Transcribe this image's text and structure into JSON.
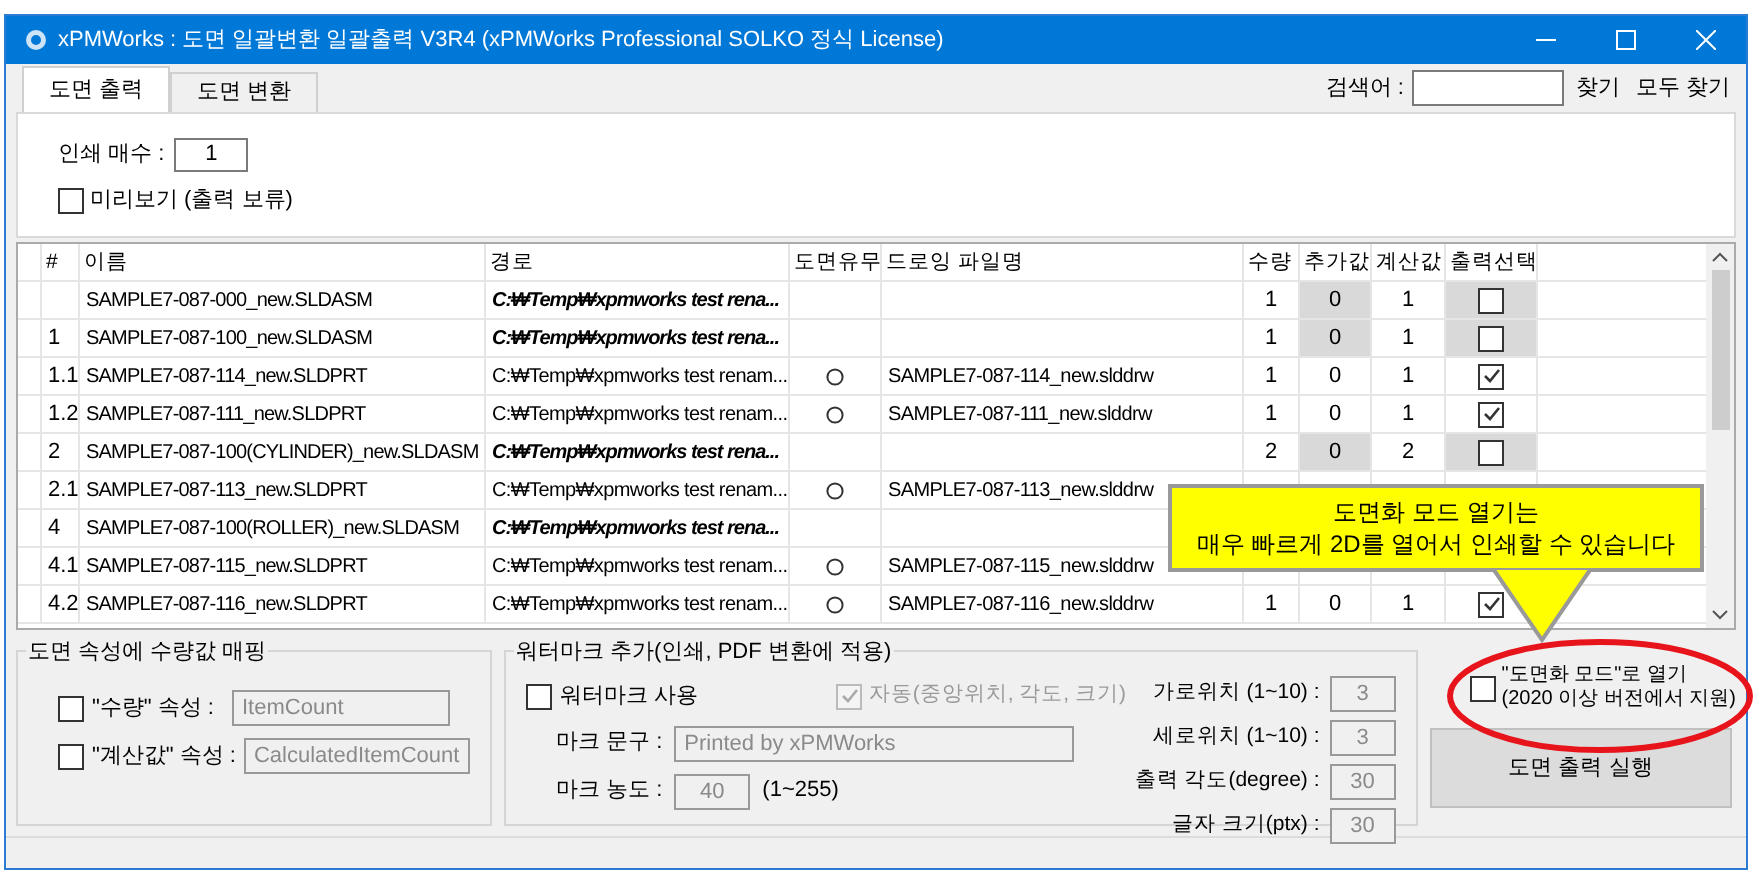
{
  "window": {
    "title": "xPMWorks : 도면 일괄변환 일괄출력 V3R4 (xPMWorks Professional SOLKO 정식 License)"
  },
  "tabs": [
    {
      "label": "도면 출력",
      "selected": true
    },
    {
      "label": "도면 변환",
      "selected": false
    }
  ],
  "search": {
    "label": "검색어 :",
    "buttons": [
      "찾기",
      "모두 찾기"
    ]
  },
  "print_count": {
    "label": "인쇄 매수 :",
    "value": "1"
  },
  "preview": {
    "label": "미리보기 (출력 보류)",
    "checked": false
  },
  "table": {
    "columns": [
      "#",
      "이름",
      "경로",
      "도면유무",
      "드로잉 파일명",
      "수량",
      "추가값",
      "계산값",
      "출력선택"
    ],
    "rows": [
      {
        "kind": "assembly",
        "name": "SAMPLE7-087-000_new.SLDASM",
        "path": "C:₩Temp₩xpmworks test rena...",
        "has_drawing": false,
        "qty": "1",
        "add": "0",
        "calc": "1",
        "checked": false
      },
      {
        "kind": "assembly",
        "num": "1",
        "name": "SAMPLE7-087-100_new.SLDASM",
        "path": "C:₩Temp₩xpmworks test rena...",
        "has_drawing": false,
        "qty": "1",
        "add": "0",
        "calc": "1",
        "checked": false
      },
      {
        "kind": "part",
        "num": "1.1",
        "name": "SAMPLE7-087-114_new.SLDPRT",
        "path": "C:₩Temp₩xpmworks test renam...",
        "has_drawing": true,
        "drawing": "SAMPLE7-087-114_new.slddrw",
        "qty": "1",
        "add": "0",
        "calc": "1",
        "checked": true
      },
      {
        "kind": "part",
        "num": "1.2",
        "name": "SAMPLE7-087-111_new.SLDPRT",
        "path": "C:₩Temp₩xpmworks test renam...",
        "has_drawing": true,
        "drawing": "SAMPLE7-087-111_new.slddrw",
        "qty": "1",
        "add": "0",
        "calc": "1",
        "checked": true
      },
      {
        "kind": "assembly",
        "num": "2",
        "name": "SAMPLE7-087-100(CYLINDER)_new.SLDASM",
        "path": "C:₩Temp₩xpmworks test rena...",
        "has_drawing": false,
        "qty": "2",
        "add": "0",
        "calc": "2",
        "checked": false
      },
      {
        "kind": "part",
        "num": "2.1",
        "name": "SAMPLE7-087-113_new.SLDPRT",
        "path": "C:₩Temp₩xpmworks test renam...",
        "has_drawing": true,
        "drawing": "SAMPLE7-087-113_new.slddrw"
      },
      {
        "kind": "assembly",
        "num": "4",
        "name": "SAMPLE7-087-100(ROLLER)_new.SLDASM",
        "path": "C:₩Temp₩xpmworks test rena...",
        "has_drawing": false
      },
      {
        "kind": "part",
        "num": "4.1",
        "name": "SAMPLE7-087-115_new.SLDPRT",
        "path": "C:₩Temp₩xpmworks test renam...",
        "has_drawing": true,
        "drawing": "SAMPLE7-087-115_new.slddrw"
      },
      {
        "kind": "part",
        "num": "4.2",
        "name": "SAMPLE7-087-116_new.SLDPRT",
        "path": "C:₩Temp₩xpmworks test renam...",
        "has_drawing": true,
        "drawing": "SAMPLE7-087-116_new.slddrw",
        "qty": "1",
        "add": "0",
        "calc": "1",
        "checked": true
      }
    ]
  },
  "callout": {
    "lines": [
      "도면화 모드 열기는",
      "매우 빠르게 2D를 열어서 인쇄할 수 있습니다"
    ]
  },
  "mapping": {
    "title": "도면 속성에 수량값 매핑",
    "items": [
      {
        "label": "\"수량\" 속성 :",
        "value": "ItemCount",
        "checked": false
      },
      {
        "label": "\"계산값\" 속성 :",
        "value": "CalculatedItemCount",
        "checked": false
      }
    ]
  },
  "watermark": {
    "title": "워터마크 추가(인쇄, PDF 변환에 적용)",
    "use": {
      "label": "워터마크 사용",
      "checked": false
    },
    "auto": {
      "label": "자동(중앙위치, 각도, 크기)",
      "checked": true,
      "disabled": true
    },
    "text": {
      "label": "마크 문구 :",
      "value": "Printed by xPMWorks"
    },
    "density": {
      "label": "마크 농도 :",
      "value": "40",
      "range": "(1~255)"
    },
    "settings": [
      {
        "label": "가로위치 (1~10) :",
        "value": "3"
      },
      {
        "label": "세로위치 (1~10) :",
        "value": "3"
      },
      {
        "label": "출력 각도(degree) :",
        "value": "30"
      },
      {
        "label": "글자 크기(ptx) :",
        "value": "30"
      }
    ]
  },
  "drawing_mode": {
    "lines": [
      "\"도면화 모드\"로 열기",
      "(2020 이상 버전에서 지원)"
    ],
    "checked": false
  },
  "run_button": "도면 출력 실행"
}
